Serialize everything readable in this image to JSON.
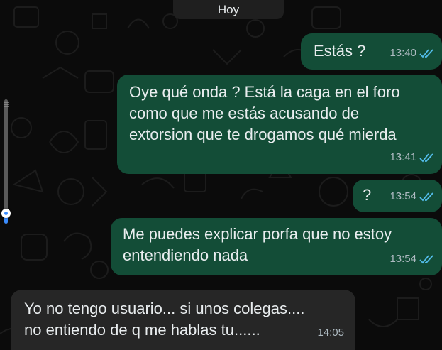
{
  "date_chip": "Hoy",
  "messages": [
    {
      "direction": "out",
      "text": "Estás ?",
      "time": "13:40",
      "status": "read"
    },
    {
      "direction": "out",
      "text": "Oye qué onda ? Está la caga en el foro\ncomo que me estás acusando de\nextorsion que te drogamos qué mierda",
      "time": "13:41",
      "status": "read"
    },
    {
      "direction": "out",
      "text": "?",
      "time": "13:54",
      "status": "read"
    },
    {
      "direction": "out",
      "text": "Me puedes explicar porfa que no estoy\nentendiendo nada",
      "time": "13:54",
      "status": "read"
    },
    {
      "direction": "in",
      "text": "Yo no tengo usuario... si unos colegas....\nno entiendo de q me hablas tu......",
      "time": "14:05"
    }
  ],
  "colors": {
    "outgoing_bubble": "#134d37",
    "incoming_bubble": "#262626",
    "read_ticks": "#53bdeb",
    "background": "#0b0b0b"
  },
  "icons": [
    "double-check-read-icon",
    "scroll-slider-knob"
  ],
  "scroll_position": 0.92
}
